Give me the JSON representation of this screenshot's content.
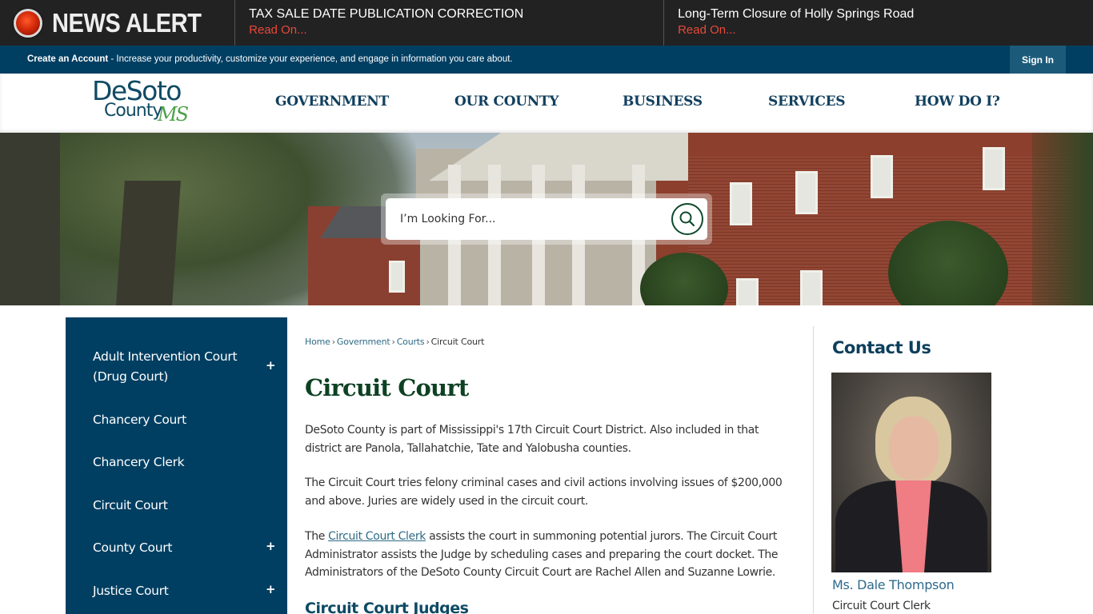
{
  "news_alert": {
    "title": "NEWS ALERT",
    "items": [
      {
        "headline": "TAX SALE DATE PUBLICATION CORRECTION",
        "link": "Read On..."
      },
      {
        "headline": "Long-Term Closure of Holly Springs Road",
        "link": "Read On..."
      }
    ]
  },
  "account_bar": {
    "create_account": "Create an Account",
    "message": " - Increase your productivity, customize your experience, and engage in information you care about.",
    "sign_in": "Sign In"
  },
  "header": {
    "logo": {
      "line1": "DeSoto",
      "line2": "County",
      "suffix": "MS"
    },
    "nav": [
      "GOVERNMENT",
      "OUR COUNTY",
      "BUSINESS",
      "SERVICES",
      "HOW DO I?"
    ]
  },
  "search": {
    "placeholder": "I’m Looking For...",
    "icon": "search-icon"
  },
  "sidebar": {
    "items": [
      {
        "label": "Adult Intervention Court (Drug Court)",
        "expandable": true,
        "toggle": "+"
      },
      {
        "label": "Chancery Court",
        "expandable": false
      },
      {
        "label": "Chancery Clerk",
        "expandable": false
      },
      {
        "label": "Circuit Court",
        "expandable": false
      },
      {
        "label": "County Court",
        "expandable": true,
        "toggle": "+"
      },
      {
        "label": "Justice Court",
        "expandable": true,
        "toggle": "+"
      }
    ]
  },
  "breadcrumb": {
    "items": [
      "Home",
      "Government",
      "Courts"
    ],
    "current": "Circuit Court",
    "separator": "›"
  },
  "main": {
    "title": "Circuit Court",
    "paragraph1": "DeSoto County is part of Mississippi's 17th Circuit Court District. Also included in that district are Panola, Tallahatchie, Tate and Yalobusha counties.",
    "paragraph2": "The Circuit Court tries felony criminal cases and civil actions involving issues of $200,000 and above. Juries are widely used in the circuit court.",
    "paragraph3_pre": "The ",
    "paragraph3_link": "Circuit Court Clerk",
    "paragraph3_post": " assists the court in summoning potential jurors. The Circuit Court Administrator assists the Judge by scheduling cases and preparing the court docket. The Administrators of the DeSoto County Circuit Court are Rachel Allen and Suzanne Lowrie.",
    "subheading": "Circuit Court Judges"
  },
  "contact": {
    "title": "Contact Us",
    "name": "Ms. Dale Thompson",
    "role": "Circuit Court Clerk"
  },
  "colors": {
    "alert_bg": "#222222",
    "read_on": "#e8483a",
    "brand_blue": "#003f62",
    "title_green": "#0d4123",
    "link": "#2f6b86"
  }
}
